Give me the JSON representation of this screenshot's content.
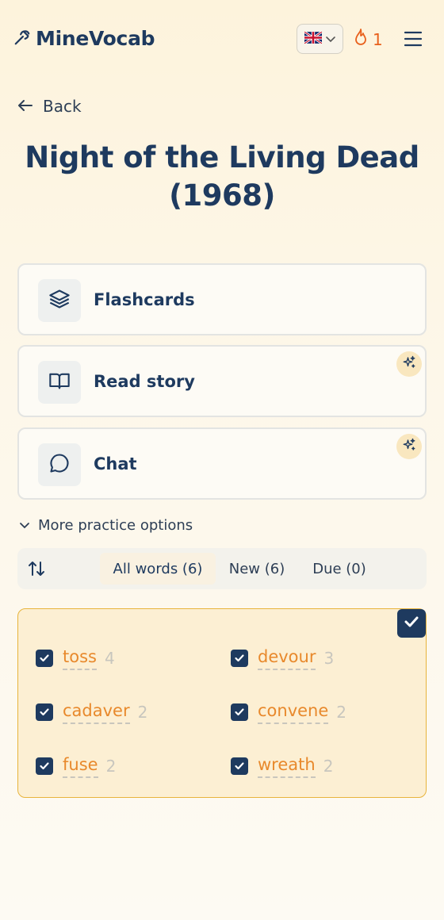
{
  "header": {
    "app_name": "MineVocab",
    "language_flag": "uk-flag",
    "streak_count": "1"
  },
  "nav": {
    "back_label": "Back"
  },
  "page": {
    "title": "Night of the Living Dead (1968)"
  },
  "practice_cards": [
    {
      "label": "Flashcards",
      "icon": "layers-icon",
      "ai": false
    },
    {
      "label": "Read story",
      "icon": "book-open-icon",
      "ai": true
    },
    {
      "label": "Chat",
      "icon": "chat-bubble-icon",
      "ai": true
    }
  ],
  "more_options_label": "More practice options",
  "filters": {
    "tabs": [
      {
        "label": "All words (6)",
        "active": true
      },
      {
        "label": "New (6)",
        "active": false
      },
      {
        "label": "Due (0)",
        "active": false
      }
    ]
  },
  "words": [
    {
      "word": "toss",
      "count": "4",
      "checked": true
    },
    {
      "word": "devour",
      "count": "3",
      "checked": true
    },
    {
      "word": "cadaver",
      "count": "2",
      "checked": true
    },
    {
      "word": "convene",
      "count": "2",
      "checked": true
    },
    {
      "word": "fuse",
      "count": "2",
      "checked": true
    },
    {
      "word": "wreath",
      "count": "2",
      "checked": true
    }
  ],
  "colors": {
    "primary": "#1e3a5f",
    "accent": "#e8892c",
    "streak": "#e8601c",
    "panel_border": "#e8b43c"
  }
}
